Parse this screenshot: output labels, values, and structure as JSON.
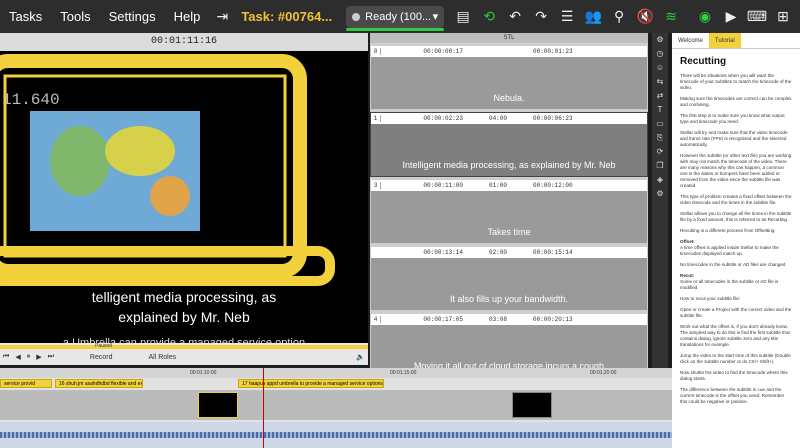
{
  "menu": [
    "Tasks",
    "Tools",
    "Settings",
    "Help"
  ],
  "task": {
    "label": "Task: #00764..."
  },
  "status": {
    "label": "Ready (100..."
  },
  "colors": {
    "accent": "#f2d13c",
    "ready": "#2ecc40",
    "topbar": "#2d2d2d"
  },
  "video": {
    "timecode": "00:01:11:16",
    "overlay_timecode": "11.640",
    "subtitle_line1": "telligent media processing, as",
    "subtitle_line2": "explained by Mr. Neb",
    "subtitle_prev": "a Umbrella can provide a managed service option"
  },
  "player": {
    "track_label": "Paused",
    "record_label": "Record",
    "roles_label": "All Roles"
  },
  "sublist": {
    "header": "STL"
  },
  "cues": [
    {
      "num": "0",
      "start": "00:00:00:17",
      "dur": "",
      "end": "00:00:01:23",
      "text": "Nebula."
    },
    {
      "num": "1",
      "start": "00:00:02:23",
      "dur": "04:00",
      "end": "00:00:06:23",
      "text": "Intelligent media processing, as explained by Mr. Neb"
    },
    {
      "num": "3",
      "start": "00:00:11:00",
      "dur": "01:00",
      "end": "00:00:12:00",
      "text": "Takes time"
    },
    {
      "num": "",
      "start": "00:00:13:14",
      "dur": "02:00",
      "end": "00:00:15:14",
      "text": "It also fills up your bandwidth."
    },
    {
      "num": "4",
      "start": "00:00:17:05",
      "dur": "03:08",
      "end": "00:00:20:13",
      "text": "Moving it all out of cloud storage incurs a cough"
    }
  ],
  "tutorial": {
    "tabs": [
      "Welcome",
      "Tutorial"
    ],
    "title": "Recutting",
    "paragraphs": [
      "There will be situations when you will want the timecode of your subtitles to match the timecode of the video.",
      "Making sure the timecodes are correct can be complex and confusing.",
      "The first step is to make sure you know what output type and timecode you need.",
      "Stellar will try and make sure that the video timecode and frame rate (FPS) is recognised and the selected automatically.",
      "However the subtitle (or other text file) you are working with may not match the timecode of the video. There are many reasons why this can happen, a common one is the slates or bumpers have been added or removed from the video since the subtitle file was created.",
      "This type of problem creates a fixed offset between the video timecode and the times in the subtitle file.",
      "Stellar allows you to change all the times in the subtitle file by a fixed amount, this is referred to as Recutting.",
      "Recutting is a different process from Offsetting:"
    ],
    "offset_head": "Offset:",
    "offset_text": "A time offset is applied inside Stellar to make the timecodes displayed match up.",
    "offset_note": "No timecodes in the subtitle or AD files are changed",
    "recut_head": "Recut:",
    "recut_text": "Some or all timecodes in the subtitle or AD file is modified",
    "paragraphs2": [
      "How to recut your subtitle file:",
      "Open or create a Project with the correct video and the subtitle file.",
      "Work out what the offset is, if you don't already know. The simplest way to do this is find the first subtitle that contains dialog, ignore subtitle zero and any title translations for example.",
      "Jump the video to the start time of this subtitle (Double click on the subtitle number or do Ctrl+ Shift+).",
      "Now shuttle the video to find the timecode where this dialog starts.",
      "The difference between the subtitle in cue and the current timecode is the offset you need. Remember this could be negative or positive."
    ]
  },
  "timeline": {
    "ruler": [
      "00:01:10:00",
      "00:01:15:00",
      "00:01:20:00"
    ],
    "subs": [
      {
        "label": "service provid"
      },
      {
        "label": "16  shuh.jm asahdhdbd flexible and expa"
      },
      {
        "label": "17  haapus appd umbrella to provide a managed service options."
      }
    ]
  }
}
